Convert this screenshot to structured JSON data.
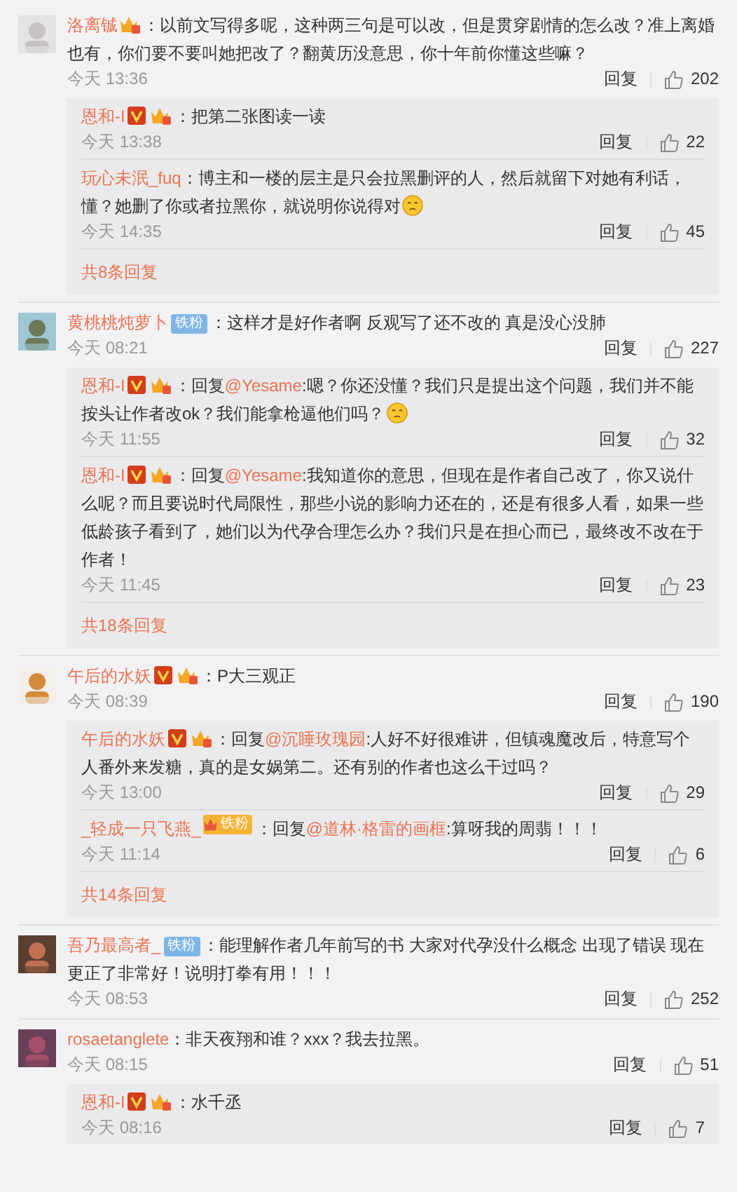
{
  "comments": [
    {
      "user": "洛离铖",
      "badges": [
        {
          "kind": "crown"
        }
      ],
      "text": "：以前文写得多呢，这种两三句是可以改，但是贯穿剧情的怎么改？准上离婚也有，你们要不要叫她把改了？翻黄历没意思，你十年前你懂这些嘛？",
      "time": "今天 13:36",
      "reply_label": "回复",
      "likes": "202",
      "replies": [
        {
          "user": "恩和-I",
          "badges": [
            {
              "kind": "v"
            },
            {
              "kind": "crown"
            }
          ],
          "text": "：把第二张图读一读",
          "time": "今天 13:38",
          "reply_label": "回复",
          "likes": "22"
        },
        {
          "user": "玩心未泯_fuq",
          "text": "：博主和一楼的层主是只会拉黑删评的人，然后就留下对她有利话，懂？她删了你或者拉黑你，就说明你说得对",
          "emoji": true,
          "time": "今天 14:35",
          "reply_label": "回复",
          "likes": "45"
        }
      ],
      "more": "共8条回复"
    },
    {
      "user": "黄桃桃炖萝卜",
      "badges": [
        {
          "kind": "fan",
          "label": "铁粉"
        }
      ],
      "text": "：这样才是好作者啊  反观写了还不改的  真是没心没肺",
      "time": "今天 08:21",
      "reply_label": "回复",
      "likes": "227",
      "replies": [
        {
          "user": "恩和-I",
          "badges": [
            {
              "kind": "v"
            },
            {
              "kind": "crown"
            }
          ],
          "prefix": "：回复",
          "mention": "@Yesame",
          "text": ":嗯？你还没懂？我们只是提出这个问题，我们并不能按头让作者改ok？我们能拿枪逼他们吗？",
          "emoji": true,
          "time": "今天 11:55",
          "reply_label": "回复",
          "likes": "32"
        },
        {
          "user": "恩和-I",
          "badges": [
            {
              "kind": "v"
            },
            {
              "kind": "crown"
            }
          ],
          "prefix": "：回复",
          "mention": "@Yesame",
          "text": ":我知道你的意思，但现在是作者自己改了，你又说什么呢？而且要说时代局限性，那些小说的影响力还在的，还是有很多人看，如果一些低龄孩子看到了，她们以为代孕合理怎么办？我们只是在担心而已，最终改不改在于作者！",
          "time": "今天 11:45",
          "reply_label": "回复",
          "likes": "23"
        }
      ],
      "more": "共18条回复"
    },
    {
      "user": "午后的水妖",
      "badges": [
        {
          "kind": "v"
        },
        {
          "kind": "crown"
        }
      ],
      "text": "：P大三观正",
      "time": "今天 08:39",
      "reply_label": "回复",
      "likes": "190",
      "replies": [
        {
          "user": "午后的水妖",
          "badges": [
            {
              "kind": "v"
            },
            {
              "kind": "crown"
            }
          ],
          "prefix": "：回复",
          "mention": "@沉睡玫瑰园",
          "text": ":人好不好很难讲，但镇魂魔改后，特意写个人番外来发糖，真的是女娲第二。还有别的作者也这么干过吗？",
          "time": "今天 13:00",
          "reply_label": "回复",
          "likes": "29"
        },
        {
          "user": "_轻成一只飞燕_",
          "badges": [
            {
              "kind": "crown-fan",
              "label": "铁粉"
            }
          ],
          "prefix": "：回复",
          "mention": "@道林·格雷的画框",
          "text": ":算呀我的周翡！！！",
          "time": "今天 11:14",
          "reply_label": "回复",
          "likes": "6"
        }
      ],
      "more": "共14条回复"
    },
    {
      "user": "吾乃最高者_",
      "badges": [
        {
          "kind": "fan",
          "label": "铁粉"
        }
      ],
      "text": "：能理解作者几年前写的书 大家对代孕没什么概念 出现了错误 现在更正了非常好！说明打拳有用！！！",
      "time": "今天 08:53",
      "reply_label": "回复",
      "likes": "252"
    },
    {
      "user": "rosaetanglete",
      "text": "：非天夜翔和谁？xxx？我去拉黑。",
      "time": "今天 08:15",
      "reply_label": "回复",
      "likes": "51",
      "replies": [
        {
          "user": "恩和-I",
          "badges": [
            {
              "kind": "v"
            },
            {
              "kind": "crown"
            }
          ],
          "text": "：水千丞",
          "time": "今天 08:16",
          "reply_label": "回复",
          "likes": "7"
        }
      ]
    }
  ]
}
